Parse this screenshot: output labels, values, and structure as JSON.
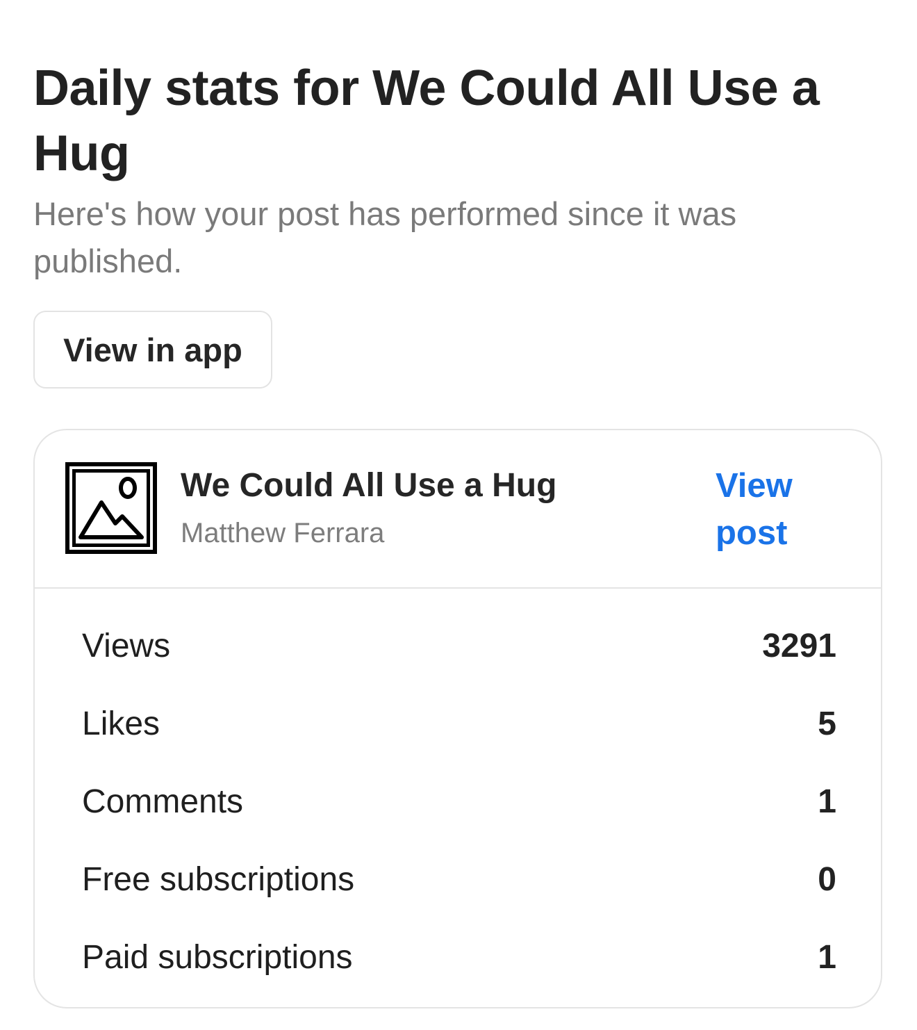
{
  "header": {
    "title": "Daily stats for We Could All Use a Hug",
    "subtitle": "Here's how your post has performed since it was published."
  },
  "actions": {
    "view_in_app_label": "View in app"
  },
  "post": {
    "title": "We Could All Use a Hug",
    "author": "Matthew Ferrara",
    "view_post_label": "View post",
    "thumbnail_icon": "image-placeholder-icon"
  },
  "stats": [
    {
      "label": "Views",
      "value": "3291"
    },
    {
      "label": "Likes",
      "value": "5"
    },
    {
      "label": "Comments",
      "value": "1"
    },
    {
      "label": "Free subscriptions",
      "value": "0"
    },
    {
      "label": "Paid subscriptions",
      "value": "1"
    }
  ],
  "colors": {
    "link": "#1a73e8",
    "title": "#222222",
    "muted": "#7a7a7a",
    "border": "#e4e4e4"
  }
}
